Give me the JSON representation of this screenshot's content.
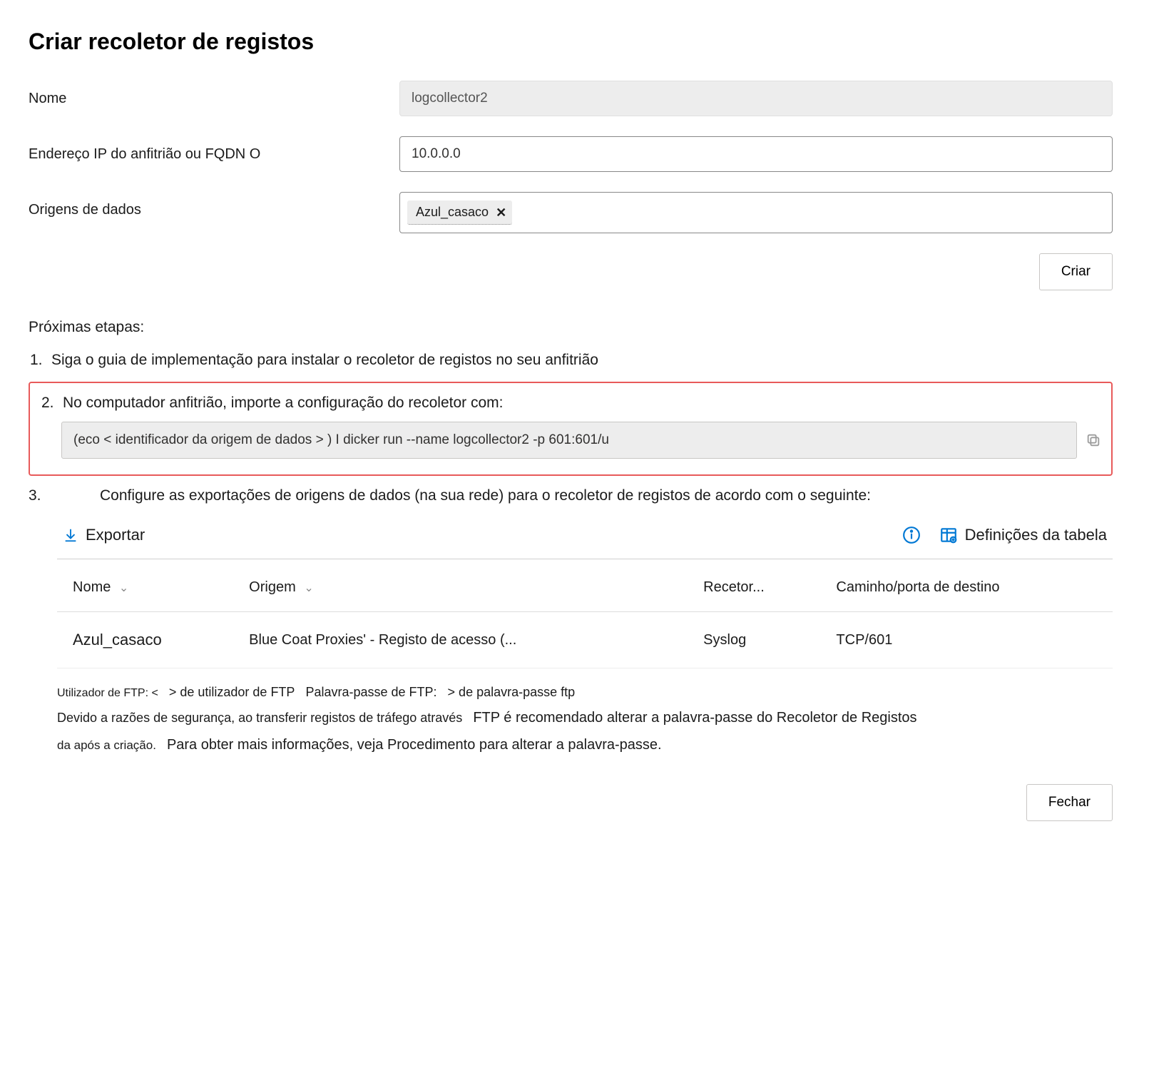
{
  "title": "Criar recoletor de registos",
  "form": {
    "name_label": "Nome",
    "name_value": "logcollector2",
    "host_label": "Endereço IP do anfitrião ou FQDN O",
    "host_value": "10.0.0.0",
    "datasources_label": "Origens de dados",
    "chip": "Azul_casaco"
  },
  "actions": {
    "create": "Criar",
    "close": "Fechar"
  },
  "steps": {
    "heading": "Próximas etapas:",
    "s1_num": "1.",
    "s1_text": "Siga o guia de implementação para instalar o recoletor de registos no seu anfitrião",
    "s2_num": "2.",
    "s2_text": "No computador anfitrião, importe a configuração do recoletor com:",
    "s2_code": "(eco < identificador da origem de dados > ) I dicker run --name logcollector2 -p 601:601/u",
    "s3_num": "3.",
    "s3_text": "Configure as exportações de origens de dados (na sua rede) para o recoletor de registos de acordo com o seguinte:"
  },
  "toolbar": {
    "export": "Exportar",
    "table_settings": "Definições da tabela"
  },
  "table": {
    "cols": {
      "name": "Nome",
      "source": "Origem",
      "receiver": "Recetor...",
      "dest": "Caminho/porta de destino"
    },
    "rows": [
      {
        "name": "Azul_casaco",
        "source": "Blue Coat Proxies' - Registo de acesso (...",
        "receiver": "Syslog",
        "dest": "TCP/601"
      }
    ]
  },
  "footer": {
    "seg1": "Utilizador de FTP: <",
    "seg2": "> de utilizador de FTP",
    "seg3": "Palavra-passe de FTP:",
    "seg4": "> de palavra-passe ftp",
    "line2a": "Devido a razões de segurança, ao transferir registos de tráfego através",
    "line2b": "FTP é recomendado alterar a palavra-passe do Recoletor de Registos",
    "line3a": "da após a criação.",
    "line3b": "Para obter mais informações, veja Procedimento para alterar a palavra-passe."
  }
}
